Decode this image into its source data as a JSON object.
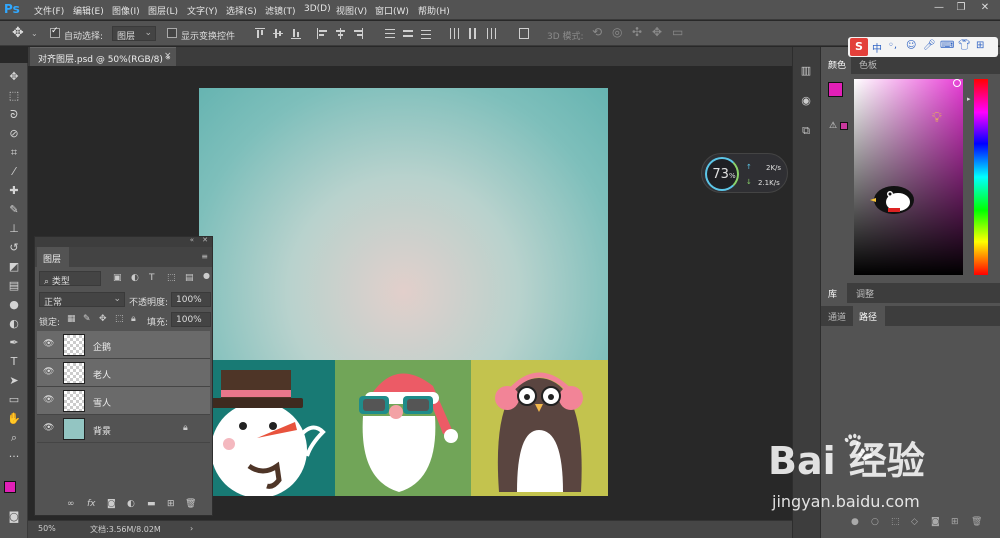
{
  "app": {
    "logo": "Ps"
  },
  "menu": [
    "文件(F)",
    "编辑(E)",
    "图像(I)",
    "图层(L)",
    "文字(Y)",
    "选择(S)",
    "滤镜(T)",
    "3D(D)",
    "视图(V)",
    "窗口(W)",
    "帮助(H)"
  ],
  "window_controls": {
    "minimize": "—",
    "restore": "❐",
    "close": "✕"
  },
  "options": {
    "auto_select_label": "自动选择:",
    "auto_select_value": "图层",
    "show_transform_label": "显示变换控件",
    "mode_3d_label": "3D 模式:"
  },
  "document": {
    "tab_label": "对齐图层.psd @ 50%(RGB/8) *",
    "close": "×"
  },
  "status": {
    "zoom": "50%",
    "doc_size": "文档:3.56M/8.02M",
    "arrow": "›"
  },
  "layers_panel": {
    "tab": "图层",
    "filter_label": "类型",
    "blend_mode": "正常",
    "opacity_label": "不透明度:",
    "opacity_value": "100%",
    "lock_label": "锁定:",
    "fill_label": "填充:",
    "fill_value": "100%",
    "layers": [
      {
        "name": "企鹅",
        "selected": true
      },
      {
        "name": "老人",
        "selected": true
      },
      {
        "name": "雪人",
        "selected": true
      },
      {
        "name": "背景",
        "selected": false,
        "locked": true
      }
    ]
  },
  "right_panels": {
    "color_tabs": [
      "颜色",
      "色板"
    ],
    "lib_tabs": [
      "库",
      "调整"
    ],
    "path_tabs": [
      "通道",
      "路径"
    ],
    "fg_color": "#e21fb7",
    "bg_color": "#ffffff"
  },
  "speed_widget": {
    "percent": "73",
    "percent_sign": "%",
    "up": "2K/s",
    "down": "2.1K/s"
  },
  "ime": {
    "logo": "S",
    "lang": "中"
  },
  "watermark": {
    "brand": "Bai 经验",
    "url": "jingyan.baidu.com"
  },
  "icons": {
    "move": "move-icon",
    "marquee": "marquee-icon",
    "lasso": "lasso-icon",
    "quick-select": "quick-select-icon",
    "crop": "crop-icon",
    "eyedropper": "eyedropper-icon",
    "healing": "healing-brush-icon",
    "brush": "brush-icon",
    "stamp": "clone-stamp-icon",
    "history": "history-brush-icon",
    "eraser": "eraser-icon",
    "gradient": "gradient-icon",
    "blur": "blur-icon",
    "dodge": "dodge-icon",
    "pen": "pen-icon",
    "type": "type-icon",
    "path-select": "path-select-icon",
    "shape": "rectangle-shape-icon",
    "hand": "hand-icon",
    "zoom": "zoom-icon"
  }
}
